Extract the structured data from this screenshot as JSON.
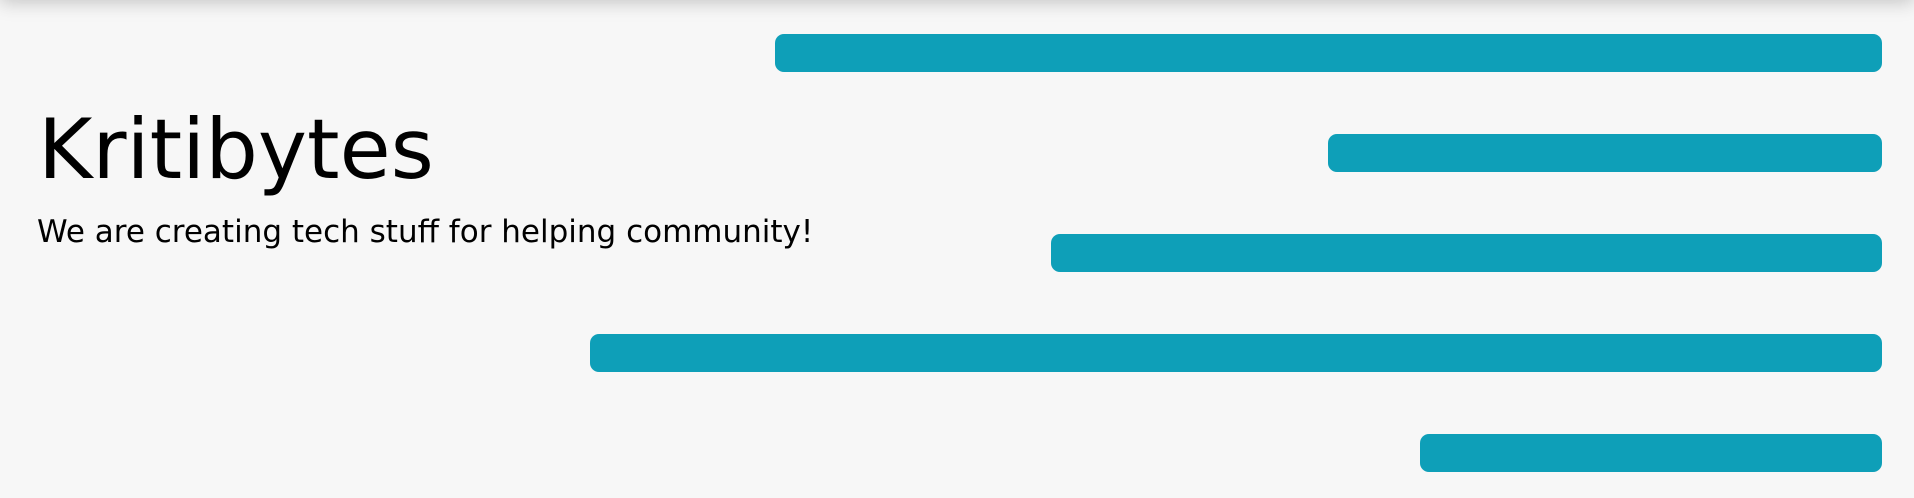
{
  "brand": {
    "title": "Kritibytes",
    "tagline": "We are creating tech stuff for helping community!"
  },
  "decor": {
    "bar_color": "#0e9fb8",
    "background_color": "#f7f7f7",
    "bars": [
      {
        "label": "decorative-bar-1"
      },
      {
        "label": "decorative-bar-2"
      },
      {
        "label": "decorative-bar-3"
      },
      {
        "label": "decorative-bar-4"
      },
      {
        "label": "decorative-bar-5"
      }
    ]
  }
}
